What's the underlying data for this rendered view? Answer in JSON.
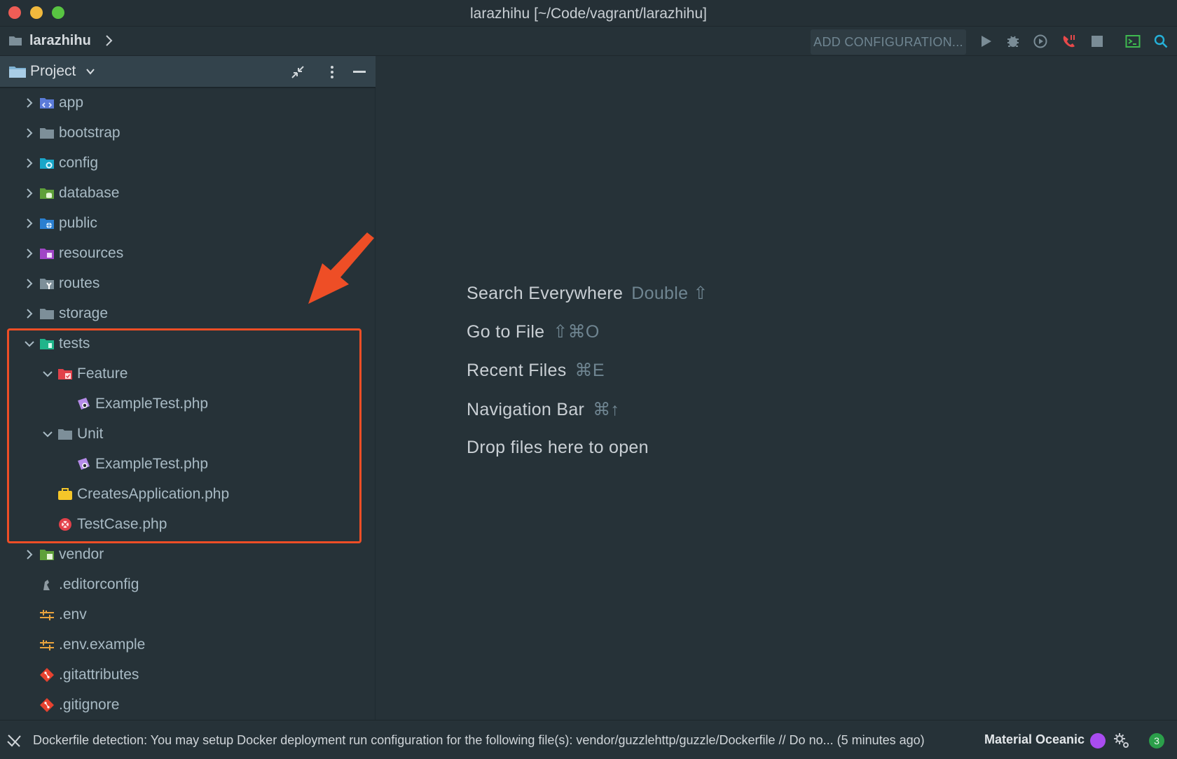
{
  "window": {
    "title": "larazhihu [~/Code/vagrant/larazhihu]"
  },
  "navbar": {
    "project": "larazhihu",
    "add_configuration": "ADD CONFIGURATION..."
  },
  "panel": {
    "title": "Project",
    "tree": [
      {
        "label": "app",
        "icon": "folder-app-icon"
      },
      {
        "label": "bootstrap",
        "icon": "folder-icon"
      },
      {
        "label": "config",
        "icon": "folder-config-icon"
      },
      {
        "label": "database",
        "icon": "folder-database-icon"
      },
      {
        "label": "public",
        "icon": "folder-public-icon"
      },
      {
        "label": "resources",
        "icon": "folder-resources-icon"
      },
      {
        "label": "routes",
        "icon": "folder-routes-icon"
      },
      {
        "label": "storage",
        "icon": "folder-icon"
      },
      {
        "label": "tests",
        "icon": "folder-tests-icon"
      },
      {
        "label": "Feature",
        "icon": "folder-feature-icon"
      },
      {
        "label": "ExampleTest.php",
        "icon": "php-file-icon"
      },
      {
        "label": "Unit",
        "icon": "folder-icon"
      },
      {
        "label": "ExampleTest.php",
        "icon": "php-file-icon"
      },
      {
        "label": "CreatesApplication.php",
        "icon": "trait-file-icon"
      },
      {
        "label": "TestCase.php",
        "icon": "abstract-class-icon"
      },
      {
        "label": "vendor",
        "icon": "folder-vendor-icon"
      },
      {
        "label": ".editorconfig",
        "icon": "editorconfig-icon"
      },
      {
        "label": ".env",
        "icon": "env-icon"
      },
      {
        "label": ".env.example",
        "icon": "env-icon"
      },
      {
        "label": ".gitattributes",
        "icon": "git-icon"
      },
      {
        "label": ".gitignore",
        "icon": "git-icon"
      }
    ]
  },
  "editor": {
    "hints": [
      {
        "action": "Search Everywhere",
        "key": "Double ⇧"
      },
      {
        "action": "Go to File",
        "key": "⇧⌘O"
      },
      {
        "action": "Recent Files",
        "key": "⌘E"
      },
      {
        "action": "Navigation Bar",
        "key": "⌘↑"
      },
      {
        "action": "Drop files here to open",
        "key": ""
      }
    ]
  },
  "statusbar": {
    "message": "Dockerfile detection: You may setup Docker deployment run configuration for the following file(s): vendor/guzzlehttp/guzzle/Dockerfile // Do no... (5 minutes ago)",
    "theme": "Material Oceanic",
    "notifications": "3"
  },
  "colors": {
    "background": "#263238",
    "highlight": "#ee4e26",
    "theme_dot": "#a94cf0"
  }
}
